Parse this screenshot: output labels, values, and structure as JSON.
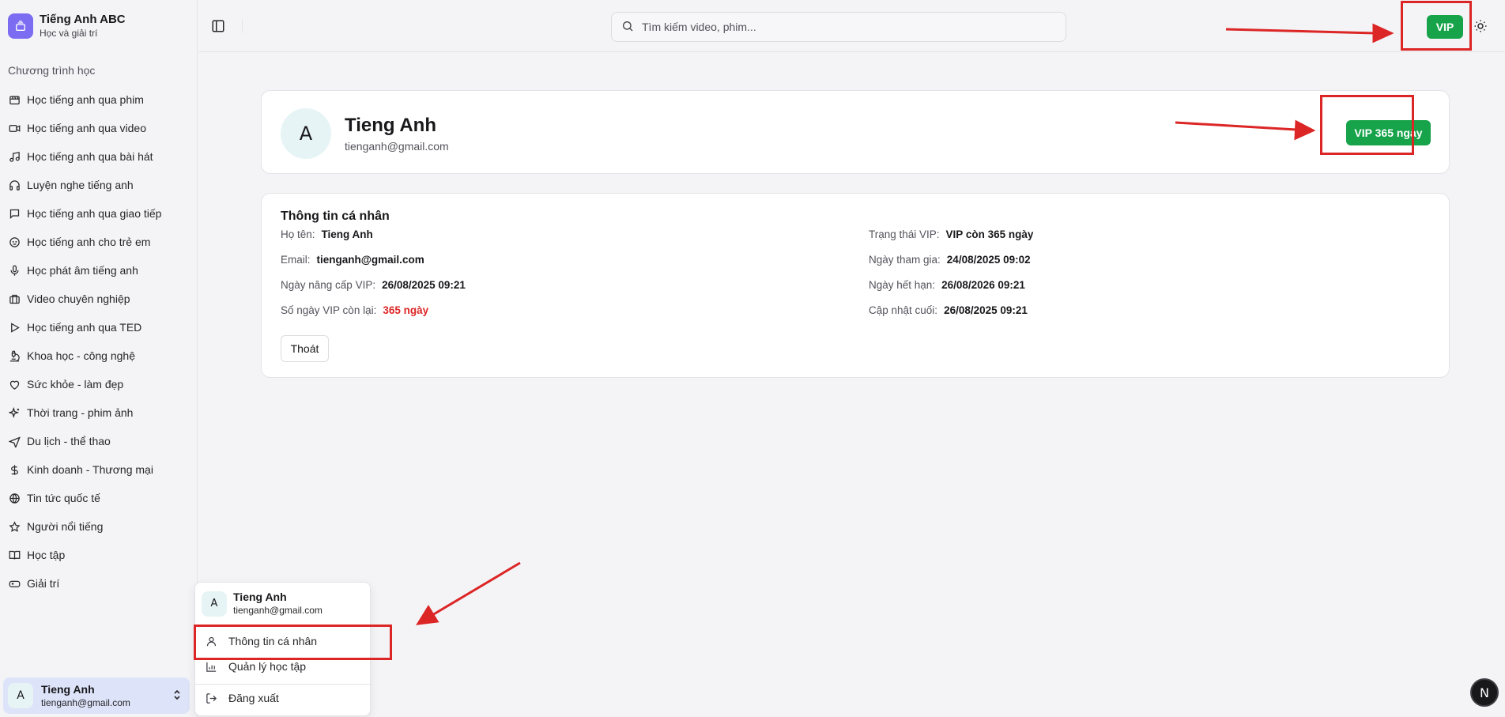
{
  "brand": {
    "title": "Tiếng Anh ABC",
    "subtitle": "Học và giải trí"
  },
  "sidebar": {
    "section_label": "Chương trình học",
    "items": [
      {
        "label": "Học tiếng anh qua phim",
        "icon": "film-icon"
      },
      {
        "label": "Học tiếng anh qua video",
        "icon": "video-icon"
      },
      {
        "label": "Học tiếng anh qua bài hát",
        "icon": "music-icon"
      },
      {
        "label": "Luyện nghe tiếng anh",
        "icon": "headphones-icon"
      },
      {
        "label": "Học tiếng anh qua giao tiếp",
        "icon": "message-icon"
      },
      {
        "label": "Học tiếng anh cho trẻ em",
        "icon": "baby-icon"
      },
      {
        "label": "Học phát âm tiếng anh",
        "icon": "mic-icon"
      },
      {
        "label": "Video chuyên nghiệp",
        "icon": "briefcase-icon"
      },
      {
        "label": "Học tiếng anh qua TED",
        "icon": "play-icon"
      },
      {
        "label": "Khoa học - công nghệ",
        "icon": "microscope-icon"
      },
      {
        "label": "Sức khỏe - làm đẹp",
        "icon": "heart-icon"
      },
      {
        "label": "Thời trang - phim ảnh",
        "icon": "sparkles-icon"
      },
      {
        "label": "Du lịch - thể thao",
        "icon": "plane-icon"
      },
      {
        "label": "Kinh doanh - Thương mại",
        "icon": "dollar-icon"
      },
      {
        "label": "Tin tức quốc tế",
        "icon": "globe-icon"
      },
      {
        "label": "Người nổi tiếng",
        "icon": "star-icon"
      },
      {
        "label": "Học tập",
        "icon": "book-icon"
      },
      {
        "label": "Giải trí",
        "icon": "gamepad-icon"
      }
    ]
  },
  "user": {
    "initial": "A",
    "name": "Tieng Anh",
    "email": "tienganh@gmail.com"
  },
  "topbar": {
    "search_placeholder": "Tìm kiếm video, phim...",
    "vip_label": "VIP"
  },
  "profile": {
    "vip_badge": "VIP 365 ngày"
  },
  "info": {
    "title": "Thông tin cá nhân",
    "left": [
      {
        "key": "Họ tên:",
        "value": "Tieng Anh"
      },
      {
        "key": "Email:",
        "value": "tienganh@gmail.com"
      },
      {
        "key": "Ngày nâng cấp VIP:",
        "value": "26/08/2025 09:21"
      },
      {
        "key": "Số ngày VIP còn lại:",
        "value": "365 ngày",
        "highlight": "#dc2626"
      }
    ],
    "right": [
      {
        "key": "Trạng thái VIP:",
        "value": "VIP còn 365 ngày"
      },
      {
        "key": "Ngày tham gia:",
        "value": "24/08/2025 09:02"
      },
      {
        "key": "Ngày hết hạn:",
        "value": "26/08/2026 09:21"
      },
      {
        "key": "Cập nhật cuối:",
        "value": "26/08/2025 09:21"
      }
    ],
    "logout_label": "Thoát"
  },
  "user_menu": {
    "items": [
      {
        "label": "Thông tin cá nhân",
        "icon": "user-icon"
      },
      {
        "label": "Quản lý học tập",
        "icon": "bar-chart-icon"
      },
      {
        "label": "Đăng xuất",
        "icon": "logout-icon"
      }
    ]
  },
  "dev_badge": "N",
  "colors": {
    "vip_green": "#16a34a",
    "annotation_red": "#dc2626",
    "brand_purple": "#7c6cf2"
  }
}
